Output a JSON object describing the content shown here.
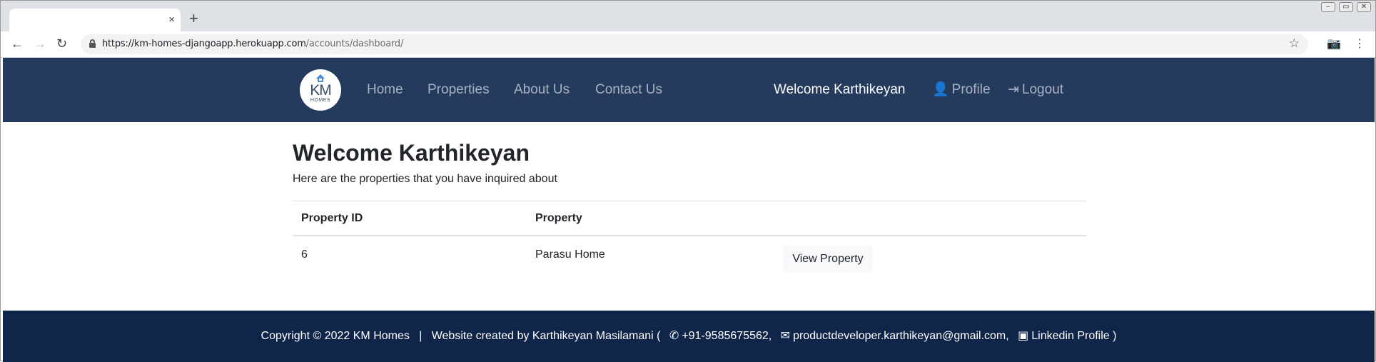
{
  "browser": {
    "tab_close": "×",
    "new_tab": "+",
    "url_host": "https://km-homes-djangoapp.herokuapp.com",
    "url_path": "/accounts/dashboard/"
  },
  "site": {
    "logo": {
      "main": "KM",
      "sub": "HOMES"
    },
    "nav": {
      "home": "Home",
      "properties": "Properties",
      "about": "About Us",
      "contact": "Contact Us",
      "welcome": "Welcome Karthikeyan",
      "profile": "Profile",
      "logout": "Logout"
    },
    "dashboard": {
      "title": "Welcome Karthikeyan",
      "subtitle": "Here are the properties that you have inquired about",
      "table": {
        "headers": [
          "Property ID",
          "Property"
        ],
        "rows": [
          {
            "id": "6",
            "property": "Parasu Home",
            "action": "View Property"
          }
        ]
      }
    },
    "footer": {
      "copyright": "Copyright © 2022 KM Homes",
      "separator": "|",
      "created_by": "Website created by Karthikeyan Masilamani (",
      "phone": "+91-9585675562,",
      "email": "productdeveloper.karthikeyan@gmail.com,",
      "linkedin": "Linkedin Profile )"
    }
  },
  "colors": {
    "navbar": "#253b5e",
    "footer": "#10254a",
    "nav_link": "#a7b1c2"
  }
}
